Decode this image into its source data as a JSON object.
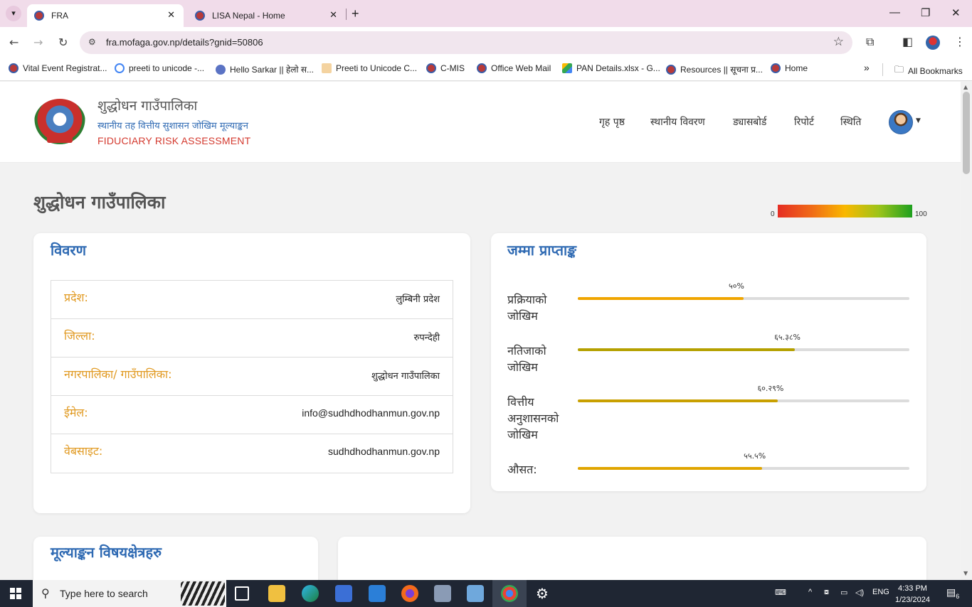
{
  "browser": {
    "tabs": [
      {
        "title": "FRA",
        "active": true
      },
      {
        "title": "LISA Nepal - Home",
        "active": false
      }
    ],
    "url": "fra.mofaga.gov.np/details?gnid=50806",
    "bookmarks": [
      "Vital Event Registrat...",
      "preeti to unicode -...",
      "Hello Sarkar || हेलो स...",
      "Preeti to Unicode C...",
      "C-MIS",
      "Office Web Mail",
      "PAN Details.xlsx - G...",
      "Resources || सूचना प्र...",
      "Home"
    ],
    "bookmarks_more": "»",
    "all_bookmarks": "All Bookmarks"
  },
  "site": {
    "name": "शुद्धोधन गाउँपालिका",
    "subtitle": "स्थानीय तह वित्तीय सुशासन जोखिम मूल्याङ्कन",
    "english_name": "FIDUCIARY RISK ASSESSMENT",
    "nav": [
      "गृह पृष्ठ",
      "स्थानीय विवरण",
      "ड्यासबोर्ड",
      "रिपोर्ट",
      "स्थिति"
    ]
  },
  "page": {
    "title": "शुद्धोधन गाउँपालिका",
    "scale": {
      "min": "0",
      "max": "100"
    }
  },
  "details_card": {
    "title": "विवरण",
    "rows": [
      {
        "label": "प्रदेश:",
        "value": "लुम्बिनी प्रदेश"
      },
      {
        "label": "जिल्ला:",
        "value": "रुपन्देही"
      },
      {
        "label": "नगरपालिका/ गाउँपालिका:",
        "value": "शुद्धोधन गाउँपालिका"
      },
      {
        "label": "ईमेल:",
        "value": "info@sudhdhodhanmun.gov.np"
      },
      {
        "label": "वेबसाइट:",
        "value": "sudhdhodhanmun.gov.np"
      }
    ]
  },
  "score_card": {
    "title": "जम्मा प्राप्ताङ्क",
    "items": [
      {
        "label": "प्रक्रियाको जोखिम",
        "percent_text": "५०%",
        "value": 50,
        "color": "#f0a500"
      },
      {
        "label": "नतिजाको जोखिम",
        "percent_text": "६५.३८%",
        "value": 65.38,
        "color": "#b5a000"
      },
      {
        "label": "वित्तीय अनुशासनको जोखिम",
        "percent_text": "६०.२९%",
        "value": 60.29,
        "color": "#c9a000"
      },
      {
        "label": "औसत:",
        "percent_text": "५५.५%",
        "value": 55.5,
        "color": "#e0a500"
      }
    ]
  },
  "areas_card": {
    "title": "मूल्याङ्कन विषयक्षेत्रहरु"
  },
  "taskbar": {
    "search_placeholder": "Type here to search",
    "lang": "ENG",
    "time": "4:33 PM",
    "date": "1/23/2024",
    "notifications": "6"
  }
}
